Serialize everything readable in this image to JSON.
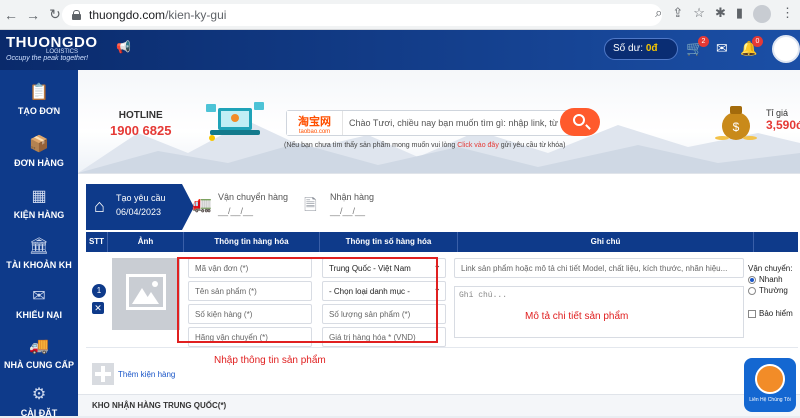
{
  "browser": {
    "host": "thuongdo.com",
    "path": "/kien-ky-gui"
  },
  "header": {
    "logo_name": "THUONGDO",
    "logo_sub": "LOGISTICS",
    "slogan": "Occupy the peak together!",
    "balance_label": "Số dư:",
    "balance_value": "0đ",
    "cart_count": "2",
    "bell_count": "0"
  },
  "sidebar": {
    "items": [
      {
        "label": "TẠO ĐƠN",
        "icon": "clipboard-icon"
      },
      {
        "label": "ĐƠN HÀNG",
        "icon": "box-icon"
      },
      {
        "label": "KIỆN HÀNG",
        "icon": "boxes-icon"
      },
      {
        "label": "TÀI KHOẢN KH",
        "icon": "bank-icon"
      },
      {
        "label": "KHIẾU NẠI",
        "icon": "complaint-icon"
      },
      {
        "label": "NHÀ CUNG CẤP",
        "icon": "supplier-icon"
      },
      {
        "label": "CÀI ĐẶT",
        "icon": "gear-icon"
      }
    ]
  },
  "banner": {
    "hotline_title": "HOTLINE",
    "hotline_number": "1900 6825",
    "taobao_cn": "淘宝网",
    "taobao_url": "taobao.com",
    "search_placeholder": "Chào Tươi, chiều nay bạn muốn tìm gì: nhập link, từ khóa...",
    "hint_prefix": "(Nếu bạn chưa tìm thấy sản phẩm mong muốn vui lòng",
    "hint_link": "Click vào đây",
    "hint_suffix": "gửi yêu cầu từ khóa)",
    "rate_label": "Tỉ giá",
    "rate_value": "3,590đ"
  },
  "steps": [
    {
      "title": "Tạo yêu cầu",
      "date": "06/04/2023"
    },
    {
      "title": "Vận chuyển hàng",
      "date": "__/__/__"
    },
    {
      "title": "Nhận hàng",
      "date": "__/__/__"
    }
  ],
  "table": {
    "headers": [
      "STT",
      "Ảnh",
      "Thông tin hàng hóa",
      "Thông tin số hàng hóa",
      "Ghi chú"
    ],
    "row_number": "1",
    "fields": {
      "tracking_ph": "Mã vận đơn (*)",
      "product_name_ph": "Tên sản phẩm (*)",
      "package_count_ph": "Số kiện hàng (*)",
      "carrier_ph": "Hãng vận chuyển (*)",
      "origin_value": "Trung Quốc - Việt Nam",
      "category_value": "- Chọn loại danh mục -",
      "quantity_ph": "Số lượng sản phẩm (*)",
      "value_ph": "Giá trị hàng hóa * (VND)",
      "link_ph": "Link sản phẩm hoặc mô tả chi tiết Model, chất liệu, kích thước, nhãn hiệu...",
      "note_ph": "Ghi chú..."
    },
    "note_annotation": "Mô tả chi tiết sản phẩm",
    "input_annotation": "Nhập thông tin sản phẩm",
    "shipping_label": "Vận chuyển:",
    "shipping_options": [
      "Nhanh",
      "Thường"
    ],
    "insurance_label": "Bảo hiểm"
  },
  "add_package": "Thêm kiện hàng",
  "warehouse_title": "KHO NHẬN HÀNG TRUNG QUỐC(*)",
  "contact_label": "Liên Hệ Chúng Tôi"
}
